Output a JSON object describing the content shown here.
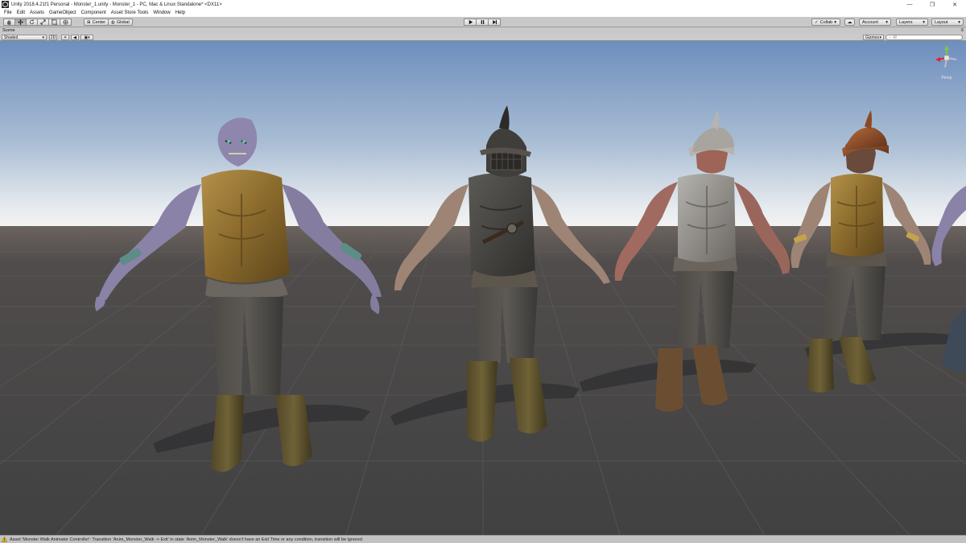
{
  "window": {
    "title": "Unity 2018.4.21f1 Personal - Monster_1.unity - Monster_1 - PC, Mac & Linux Standalone* <DX11>",
    "controls": [
      "—",
      "❐",
      "✕"
    ]
  },
  "menu": [
    "File",
    "Edit",
    "Assets",
    "GameObject",
    "Component",
    "Asset Store Tools",
    "Window",
    "Help"
  ],
  "toolbar": {
    "pivot_label": "Center",
    "space_label": "Global",
    "collab_label": "Collab",
    "account_label": "Account",
    "layers_label": "Layers",
    "layout_label": "Layout"
  },
  "scene": {
    "tab_label": "Scene",
    "shading_mode": "Shaded",
    "mode_2d": "2D",
    "gizmos_label": "Gizmos",
    "search_placeholder": "All",
    "projection_label": "Persp"
  },
  "status": {
    "message": "Asset 'Monster Walk Animator Controller': Transition 'Anim_Monster_Walk -> Exit' in state 'Anim_Monster_Walk' doesn't have an Exit Time or any condition, transition will be ignored"
  },
  "colors": {
    "sky_top": "#6f8fbf",
    "sky_horizon": "#e9eef2",
    "ground": "#4a4a4b",
    "toolbar": "#c8c8c8",
    "gizmo_x": "#d62828",
    "gizmo_y": "#7ac943",
    "gizmo_z": "#3c6fd8"
  },
  "icons": {
    "hand_tool": "hand-icon",
    "move_tool": "move-icon",
    "rotate_tool": "rotate-icon",
    "scale_tool": "scale-icon",
    "rect_tool": "rect-icon",
    "transform_tool": "transform-icon",
    "play": "play-icon",
    "pause": "pause-icon",
    "step": "step-icon",
    "warning": "warning-icon"
  }
}
